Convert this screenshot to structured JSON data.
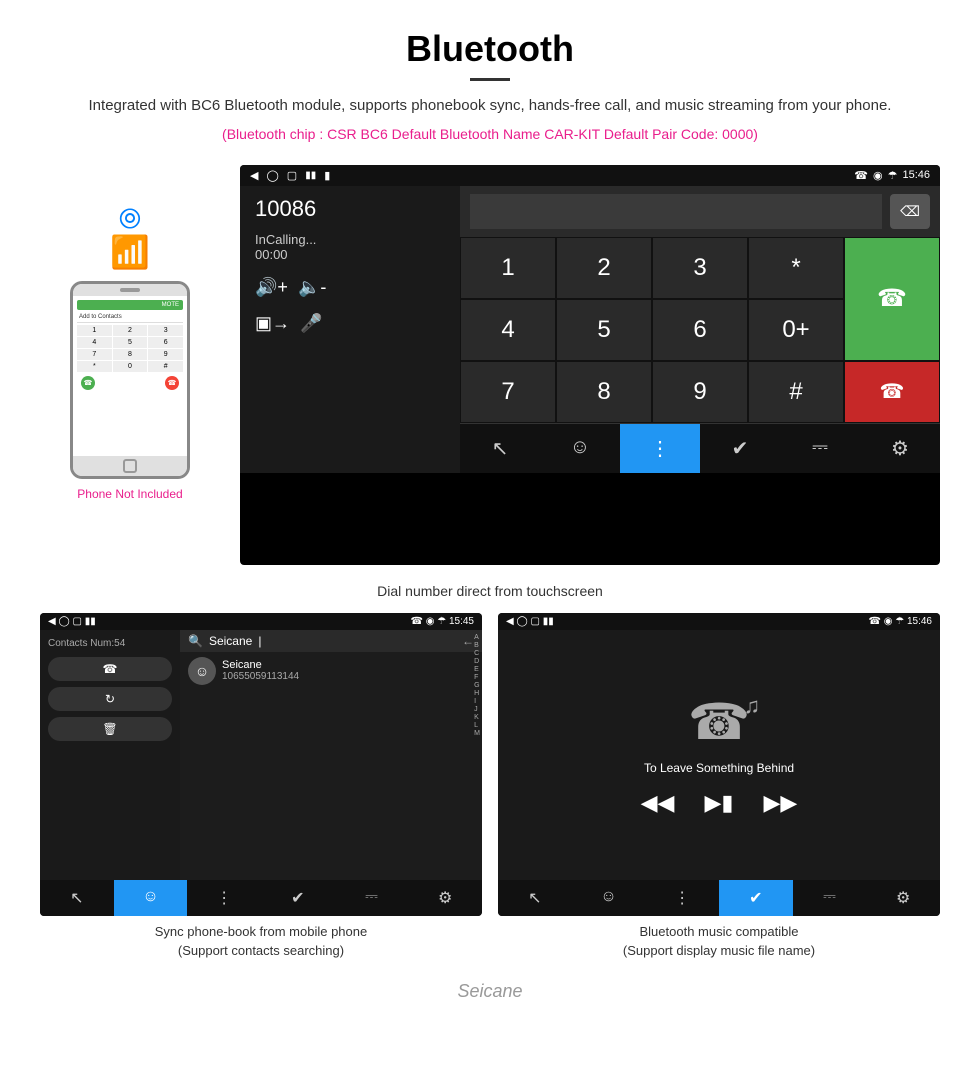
{
  "header": {
    "title": "Bluetooth",
    "description": "Integrated with BC6 Bluetooth module, supports phonebook sync, hands-free call, and music streaming from your phone.",
    "chip_info": "(Bluetooth chip : CSR BC6    Default Bluetooth Name CAR-KIT    Default Pair Code: 0000)"
  },
  "phone": {
    "label": "Phone Not Included",
    "add_contacts_text": "Add to Contacts"
  },
  "main_screen": {
    "status_time": "15:46",
    "status_icons": "▲ ♥ ▼",
    "number": "10086",
    "call_status": "InCalling...",
    "call_timer": "00:00",
    "numpad": [
      "1",
      "2",
      "3",
      "*",
      "4",
      "5",
      "6",
      "0+",
      "7",
      "8",
      "9",
      "#"
    ],
    "bottom_nav": [
      "phone-transfer",
      "contact",
      "dialpad",
      "bluetooth",
      "phone-out",
      "settings"
    ]
  },
  "caption_main": "Dial number direct from touchscreen",
  "contacts_screen": {
    "status_time": "15:45",
    "contacts_num": "Contacts Num:54",
    "search_placeholder": "Seicane",
    "contact_number": "10655059113144",
    "alphabet": [
      "A",
      "B",
      "C",
      "D",
      "E",
      "F",
      "G",
      "H",
      "I",
      "J",
      "K",
      "L",
      "M"
    ],
    "nav": [
      "call",
      "contacts",
      "dialpad",
      "bluetooth",
      "phone-out",
      "settings"
    ],
    "active_nav": 1
  },
  "caption_contacts_line1": "Sync phone-book from mobile phone",
  "caption_contacts_line2": "(Support contacts searching)",
  "music_screen": {
    "status_time": "15:46",
    "song_title": "To Leave Something Behind",
    "nav": [
      "call",
      "contacts",
      "dialpad",
      "bluetooth",
      "phone-out",
      "settings"
    ],
    "active_nav": 3
  },
  "caption_music_line1": "Bluetooth music compatible",
  "caption_music_line2": "(Support display music file name)",
  "watermark": "Seicane"
}
